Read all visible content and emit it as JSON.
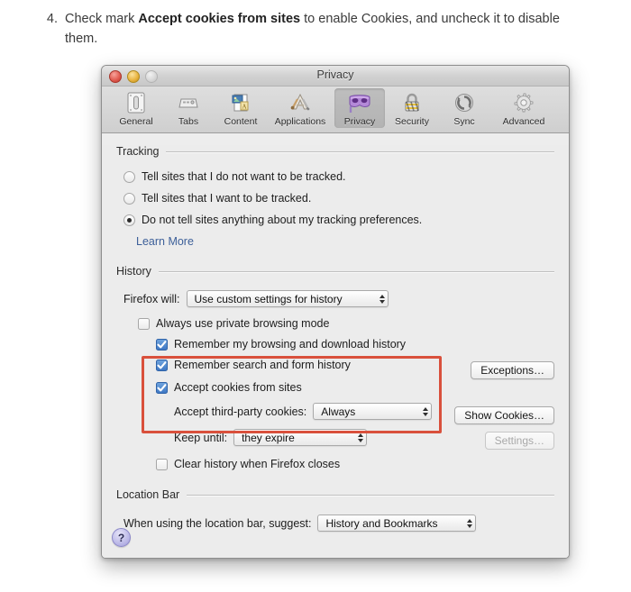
{
  "instruction": {
    "number": "4.",
    "prefix": "Check mark ",
    "bold": "Accept cookies from sites",
    "suffix": " to enable Cookies, and uncheck it to disable them."
  },
  "window": {
    "title": "Privacy",
    "traffic_lights": [
      "close",
      "minimize",
      "zoom"
    ]
  },
  "toolbar": {
    "items": [
      {
        "label": "General",
        "icon": "general-icon",
        "selected": false
      },
      {
        "label": "Tabs",
        "icon": "tabs-icon",
        "selected": false
      },
      {
        "label": "Content",
        "icon": "content-icon",
        "selected": false
      },
      {
        "label": "Applications",
        "icon": "applications-icon",
        "selected": false
      },
      {
        "label": "Privacy",
        "icon": "privacy-mask-icon",
        "selected": true
      },
      {
        "label": "Security",
        "icon": "padlock-icon",
        "selected": false
      },
      {
        "label": "Sync",
        "icon": "sync-arrows-icon",
        "selected": false
      },
      {
        "label": "Advanced",
        "icon": "gear-icon",
        "selected": false
      }
    ]
  },
  "tracking": {
    "heading": "Tracking",
    "options": [
      {
        "label": "Tell sites that I do not want to be tracked.",
        "selected": false
      },
      {
        "label": "Tell sites that I want to be tracked.",
        "selected": false
      },
      {
        "label": "Do not tell sites anything about my tracking preferences.",
        "selected": true
      }
    ],
    "learn_more": "Learn More"
  },
  "history": {
    "heading": "History",
    "firefox_will_label": "Firefox will:",
    "firefox_will_value": "Use custom settings for history",
    "always_private": {
      "label": "Always use private browsing mode",
      "checked": false
    },
    "remember_browsing": {
      "label": "Remember my browsing and download history",
      "checked": true
    },
    "remember_search": {
      "label": "Remember search and form history",
      "checked": true
    },
    "accept_cookies": {
      "label": "Accept cookies from sites",
      "checked": true
    },
    "third_party_label": "Accept third-party cookies:",
    "third_party_value": "Always",
    "keep_until_label": "Keep until:",
    "keep_until_value": "they expire",
    "clear_history": {
      "label": "Clear history when Firefox closes",
      "checked": false
    },
    "exceptions_button": "Exceptions…",
    "show_cookies_button": "Show Cookies…",
    "settings_button": "Settings…",
    "settings_disabled": true,
    "highlight_color": "#d9503c"
  },
  "location_bar": {
    "heading": "Location Bar",
    "suggest_label": "When using the location bar, suggest:",
    "suggest_value": "History and Bookmarks"
  },
  "footer": {
    "help_glyph": "?"
  }
}
